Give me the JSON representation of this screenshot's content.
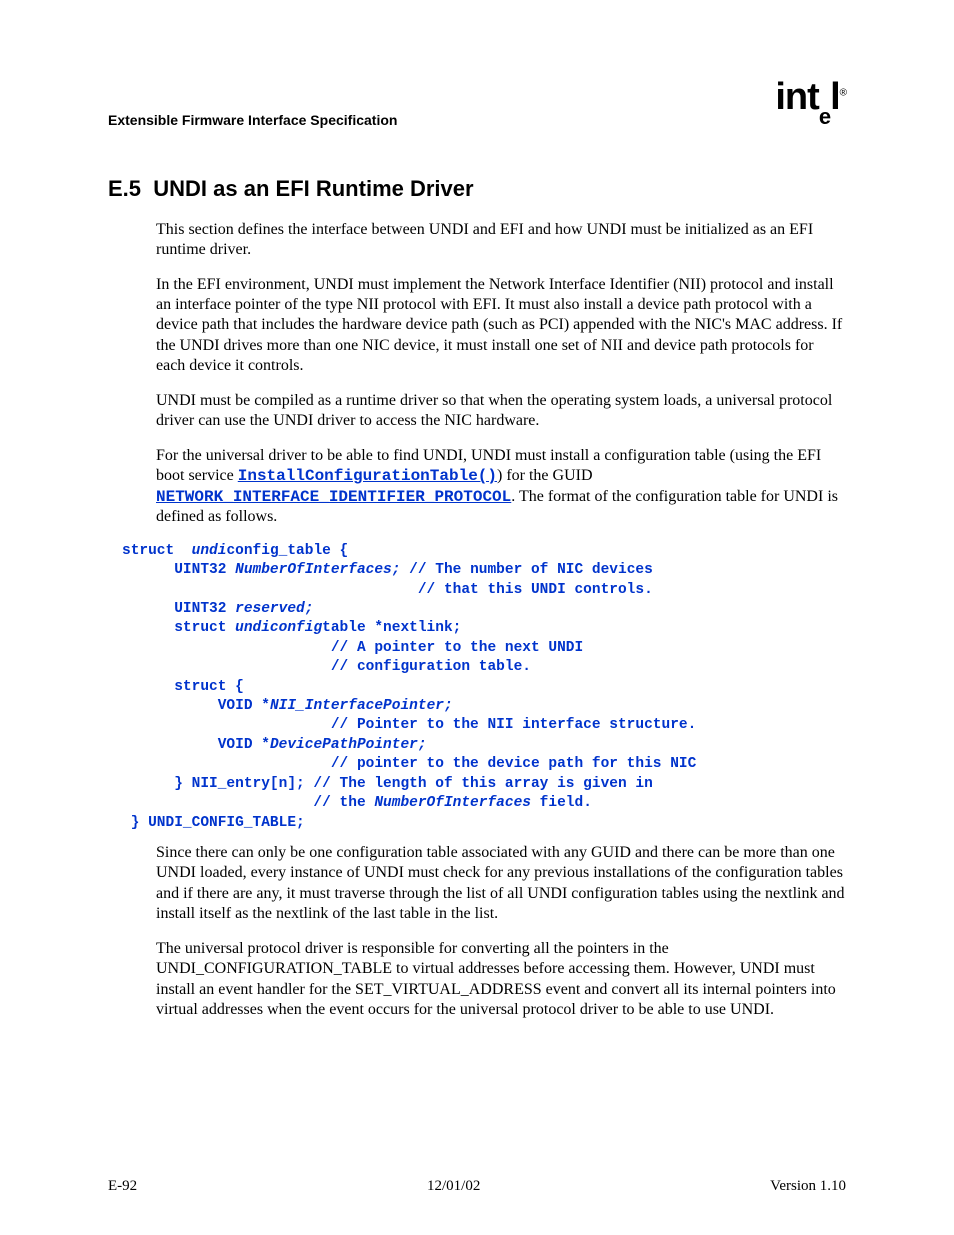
{
  "header": {
    "left": "Extensible Firmware Interface Specification",
    "logo_prefix": "int",
    "logo_sub": "e",
    "logo_suffix": "l",
    "logo_reg": "®"
  },
  "section": {
    "number": "E.5",
    "title": "UNDI as an EFI Runtime Driver"
  },
  "paragraphs": {
    "p1": "This section defines the interface between UNDI and EFI and how UNDI must be initialized as an EFI runtime driver.",
    "p2": "In the EFI environment, UNDI must implement the Network Interface Identifier (NII) protocol and install an interface pointer of the type NII protocol with EFI. It must also install a device path protocol with a device path that includes the hardware device path (such as PCI) appended with the NIC's MAC address. If the UNDI drives more than one NIC device, it must install one set of NII and device path protocols for each device it controls.",
    "p3": "UNDI must be compiled as a runtime driver so that when the operating system loads, a universal protocol driver can use the UNDI driver to access the NIC hardware.",
    "p4_a": "For the universal driver to be able to find UNDI, UNDI must install a configuration table (using the EFI boot service ",
    "p4_link1": "InstallConfigurationTable()",
    "p4_b": ") for the GUID ",
    "p4_link2": "NETWORK_INTERFACE_IDENTIFIER_PROTOCOL",
    "p4_c": ". The format of the configuration table for UNDI is defined as follows.",
    "p5": "Since there can only be one configuration table associated with any GUID and there can be more than one UNDI loaded, every instance of UNDI must check for any previous installations of the configuration tables and if there are any, it must traverse through the list of all UNDI configuration tables using the nextlink and install itself as the nextlink of the last table in the list.",
    "p6": "The universal protocol driver is responsible for converting all the pointers in the UNDI_CONFIGURATION_TABLE to virtual addresses before accessing them. However, UNDI must install an event handler for the SET_VIRTUAL_ADDRESS event and convert all its internal pointers into virtual addresses when the event occurs for the universal protocol driver to be able to use UNDI."
  },
  "code": {
    "l01a": "struct  ",
    "l01b": "undi",
    "l01c": "config_table {",
    "l02a": "      UINT32 ",
    "l02b": "NumberOfInterfaces;",
    "l02c": " // The number of NIC devices",
    "l03": "                                  // that this UNDI controls.",
    "l04a": "      UINT32 ",
    "l04b": "reserved;",
    "l05a": "      struct ",
    "l05b": "undiconfig",
    "l05c": "table *nextlink;",
    "l06": "                        // A pointer to the next UNDI",
    "l07": "                        // configuration table.",
    "l08": "      struct {",
    "l09a": "           VOID *",
    "l09b": "NII_InterfacePointer;",
    "l10": "                        // Pointer to the NII interface structure.",
    "l11a": "           VOID *",
    "l11b": "DevicePathPointer;",
    "l12": "                        // pointer to the device path for this NIC",
    "l13": "      } NII_entry[n]; // The length of this array is given in",
    "l14a": "                      // the ",
    "l14b": "NumberOfInterfaces",
    "l14c": " field.",
    "l15": " } UNDI_CONFIG_TABLE;"
  },
  "footer": {
    "left": "E-92",
    "center": "12/01/02",
    "right": "Version 1.10"
  }
}
